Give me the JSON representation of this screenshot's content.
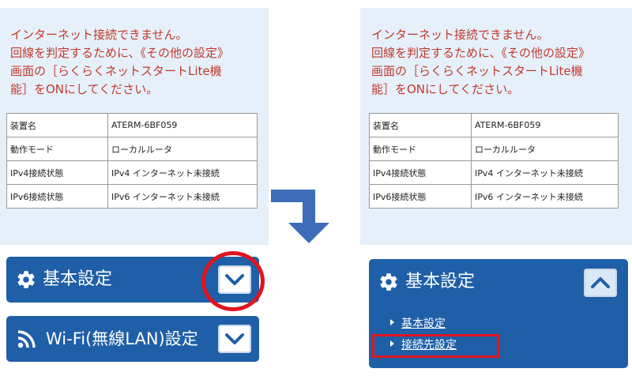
{
  "left": {
    "message": "インターネット接続できません。\n回線を判定するために、《その他の設定》\n画面の［らくらくネットスタートLite機\n能］をONにしてください。",
    "status_rows": [
      {
        "label": "装置名",
        "value": "ATERM-6BF059"
      },
      {
        "label": "動作モード",
        "value": "ローカルルータ"
      },
      {
        "label": "IPv4接続状態",
        "value": "IPv4 インターネット未接続"
      },
      {
        "label": "IPv6接続状態",
        "value": "IPv6 インターネット未接続"
      }
    ],
    "basic_settings_label": "基本設定",
    "wifi_settings_label": "Wi-Fi(無線LAN)設定"
  },
  "right": {
    "message": "インターネット接続できません。\n回線を判定するために、《その他の設定》\n画面の［らくらくネットスタートLite機\n能］をONにしてください。",
    "status_rows": [
      {
        "label": "装置名",
        "value": "ATERM-6BF059"
      },
      {
        "label": "動作モード",
        "value": "ローカルルータ"
      },
      {
        "label": "IPv4接続状態",
        "value": "IPv4 インターネット未接続"
      },
      {
        "label": "IPv6接続状態",
        "value": "IPv6 インターネット未接続"
      }
    ],
    "basic_settings_label": "基本設定",
    "submenu": [
      "基本設定",
      "接続先設定"
    ]
  },
  "colors": {
    "message_text": "#c0392b",
    "panel_bg": "#e6f0fb",
    "bar_bg": "#1f5fa8",
    "highlight": "#e0141e",
    "arrow": "#3d6db8"
  },
  "icons": {
    "settings": "gear-icon",
    "wifi": "wifi-icon",
    "expand": "chevron-down-icon",
    "collapse": "chevron-up-icon",
    "submenu_bullet": "triangle-right-icon"
  }
}
